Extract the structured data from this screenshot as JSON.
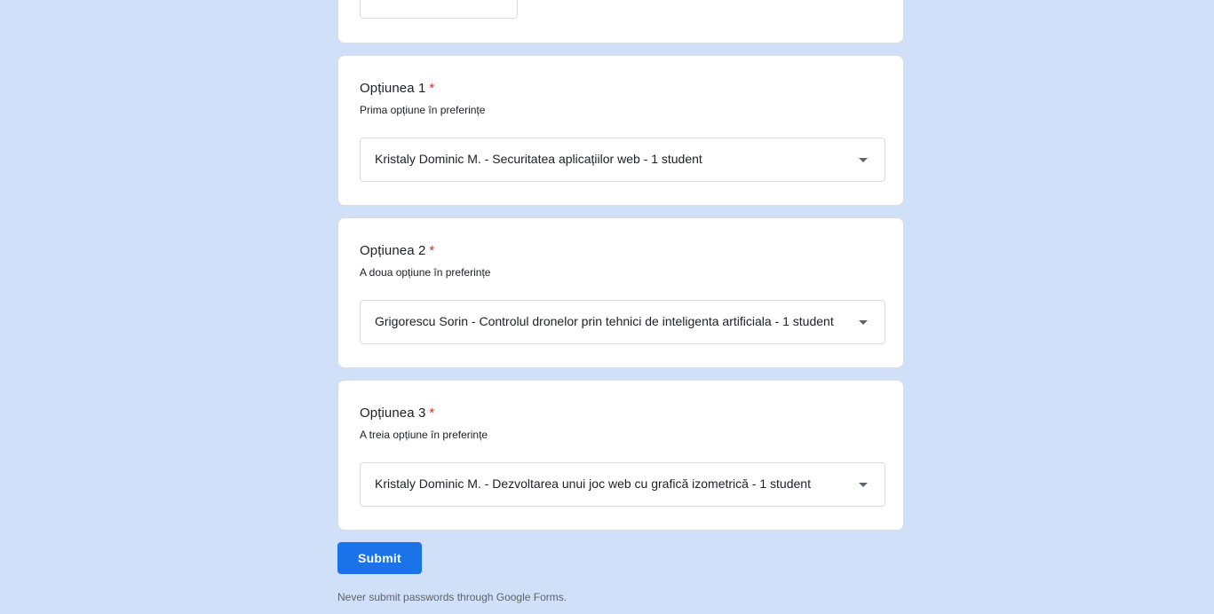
{
  "form": {
    "questions": [
      {
        "title": "Opțiunea 1",
        "required_mark": "*",
        "description": "Prima opțiune în preferințe",
        "selected": "Kristaly Dominic M. - Securitatea aplicațiilor web - 1 student"
      },
      {
        "title": "Opțiunea 2",
        "required_mark": "*",
        "description": "A doua opțiune în preferințe",
        "selected": "Grigorescu Sorin - Controlul dronelor prin tehnici de inteligenta artificiala - 1 student"
      },
      {
        "title": "Opțiunea 3",
        "required_mark": "*",
        "description": "A treia opțiune în preferințe",
        "selected": "Kristaly Dominic M. - Dezvoltarea unui joc web cu grafică izometrică - 1 student"
      }
    ],
    "submit_label": "Submit",
    "footer_note": "Never submit passwords through Google Forms."
  },
  "icons": {
    "dropdown": "chevron-down-icon"
  },
  "colors": {
    "background": "#d0e0f8",
    "accent": "#1a73e8",
    "required": "#d93025"
  }
}
